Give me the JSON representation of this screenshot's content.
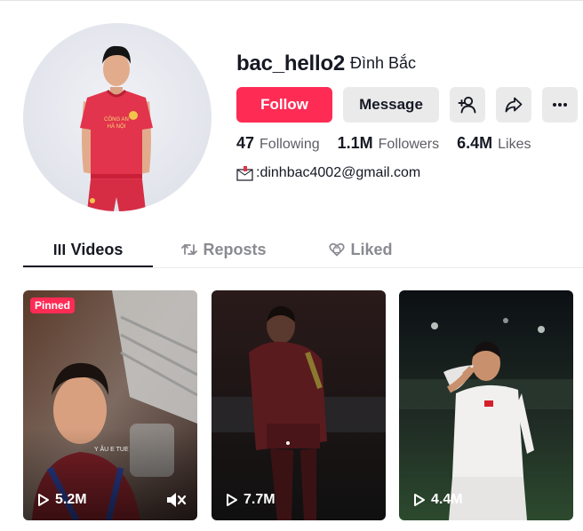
{
  "profile": {
    "username": "bac_hello2",
    "nickname": "Đình Bắc",
    "bio_email": ":dinhbac4002@gmail.com",
    "avatar_jersey_text_1": "CÔNG AN",
    "avatar_jersey_text_2": "HÀ NỘI"
  },
  "actions": {
    "follow_label": "Follow",
    "message_label": "Message"
  },
  "stats": {
    "following_count": "47",
    "following_label": "Following",
    "followers_count": "1.1M",
    "followers_label": "Followers",
    "likes_count": "6.4M",
    "likes_label": "Likes"
  },
  "tabs": [
    {
      "label": "Videos",
      "active": true
    },
    {
      "label": "Reposts",
      "active": false
    },
    {
      "label": "Liked",
      "active": false
    }
  ],
  "videos": [
    {
      "views": "5.2M",
      "pinned_label": "Pinned",
      "caption": "Y ÂU E TUE",
      "muted": true
    },
    {
      "views": "7.7M"
    },
    {
      "views": "4.4M"
    }
  ],
  "icons": [
    "add-user-icon",
    "share-icon",
    "more-icon",
    "email-icon",
    "grid-icon",
    "repost-icon",
    "liked-icon",
    "play-icon",
    "mute-icon"
  ],
  "colors": {
    "accent": "#fe2c55",
    "text": "#161823",
    "secondary_text": "#5c5d64",
    "button_bg": "#eaeaeb"
  }
}
